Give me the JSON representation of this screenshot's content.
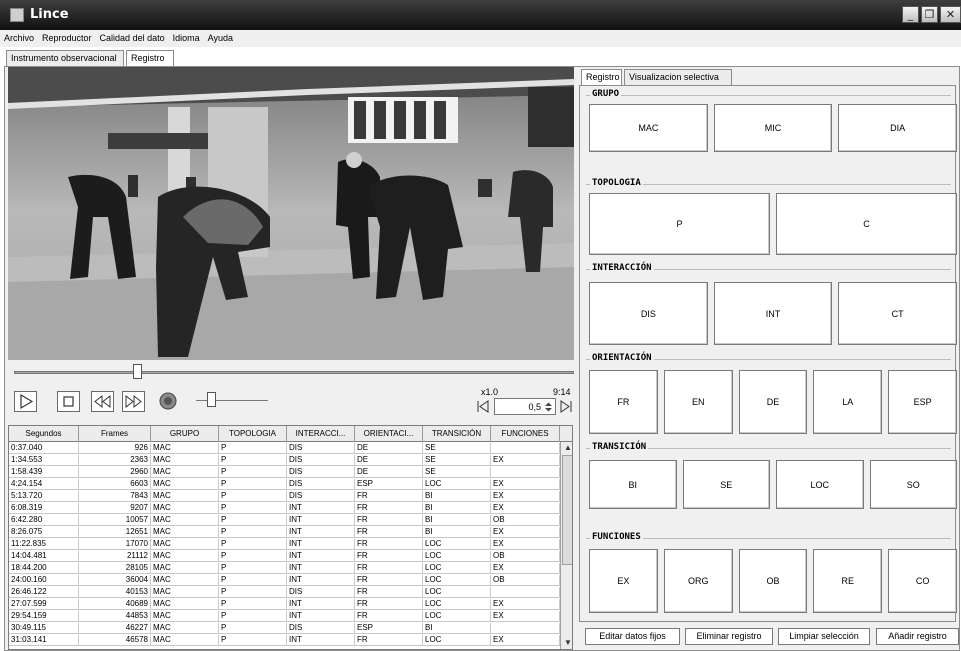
{
  "window": {
    "title": "Lince"
  },
  "menu": [
    "Archivo",
    "Reproductor",
    "Calidad del dato",
    "Idioma",
    "Ayuda"
  ],
  "main_tabs": [
    "Instrumento observacional",
    "Registro"
  ],
  "right_tabs": [
    "Registro",
    "Visualizacion selectiva"
  ],
  "player": {
    "speed": "x1.0",
    "time": "9:14",
    "step": "0,5"
  },
  "table": {
    "headers": [
      "Segundos",
      "Frames",
      "GRUPO",
      "TOPOLOGIA",
      "INTERACCI...",
      "ORIENTACI...",
      "TRANSICIÓN",
      "FUNCIONES"
    ],
    "rows": [
      [
        "0:37.040",
        "926",
        "MAC",
        "P",
        "DIS",
        "DE",
        "SE",
        ""
      ],
      [
        "1:34.553",
        "2363",
        "MAC",
        "P",
        "DIS",
        "DE",
        "SE",
        "EX"
      ],
      [
        "1:58.439",
        "2960",
        "MAC",
        "P",
        "DIS",
        "DE",
        "SE",
        ""
      ],
      [
        "4:24.154",
        "6603",
        "MAC",
        "P",
        "DIS",
        "ESP",
        "LOC",
        "EX"
      ],
      [
        "5:13.720",
        "7843",
        "MAC",
        "P",
        "DIS",
        "FR",
        "BI",
        "EX"
      ],
      [
        "6:08.319",
        "9207",
        "MAC",
        "P",
        "INT",
        "FR",
        "BI",
        "EX"
      ],
      [
        "6:42.280",
        "10057",
        "MAC",
        "P",
        "INT",
        "FR",
        "BI",
        "OB"
      ],
      [
        "8:26.075",
        "12651",
        "MAC",
        "P",
        "INT",
        "FR",
        "BI",
        "EX"
      ],
      [
        "11:22.835",
        "17070",
        "MAC",
        "P",
        "INT",
        "FR",
        "LOC",
        "EX"
      ],
      [
        "14:04.481",
        "21112",
        "MAC",
        "P",
        "INT",
        "FR",
        "LOC",
        "OB"
      ],
      [
        "18:44.200",
        "28105",
        "MAC",
        "P",
        "INT",
        "FR",
        "LOC",
        "EX"
      ],
      [
        "24:00.160",
        "36004",
        "MAC",
        "P",
        "INT",
        "FR",
        "LOC",
        "OB"
      ],
      [
        "26:46.122",
        "40153",
        "MAC",
        "P",
        "DIS",
        "FR",
        "LOC",
        ""
      ],
      [
        "27:07.599",
        "40689",
        "MAC",
        "P",
        "INT",
        "FR",
        "LOC",
        "EX"
      ],
      [
        "29:54.159",
        "44853",
        "MAC",
        "P",
        "INT",
        "FR",
        "LOC",
        "EX"
      ],
      [
        "30:49.115",
        "46227",
        "MAC",
        "P",
        "DIS",
        "ESP",
        "BI",
        ""
      ],
      [
        "31:03.141",
        "46578",
        "MAC",
        "P",
        "INT",
        "FR",
        "LOC",
        "EX"
      ]
    ]
  },
  "groups": [
    {
      "label": "GRUPO",
      "buttons": [
        "MAC",
        "MIC",
        "DIA"
      ]
    },
    {
      "label": "TOPOLOGIA",
      "buttons": [
        "P",
        "C"
      ]
    },
    {
      "label": "INTERACCIÓN",
      "buttons": [
        "DIS",
        "INT",
        "CT"
      ]
    },
    {
      "label": "ORIENTACIÓN",
      "buttons": [
        "FR",
        "EN",
        "DE",
        "LA",
        "ESP"
      ]
    },
    {
      "label": "TRANSICIÓN",
      "buttons": [
        "BI",
        "SE",
        "LOC",
        "SO"
      ]
    },
    {
      "label": "FUNCIONES",
      "buttons": [
        "EX",
        "ORG",
        "OB",
        "RE",
        "CO"
      ]
    }
  ],
  "actions": [
    "Editar datos fijos",
    "Eliminar registro",
    "Limpiar selección",
    "Añadir registro"
  ],
  "icons": [
    "app-icon",
    "minimize-icon",
    "maximize-icon",
    "close-icon",
    "play-icon",
    "stop-icon",
    "rewind-icon",
    "fast-forward-icon",
    "volume-icon",
    "frame-start-icon",
    "frame-end-icon"
  ]
}
